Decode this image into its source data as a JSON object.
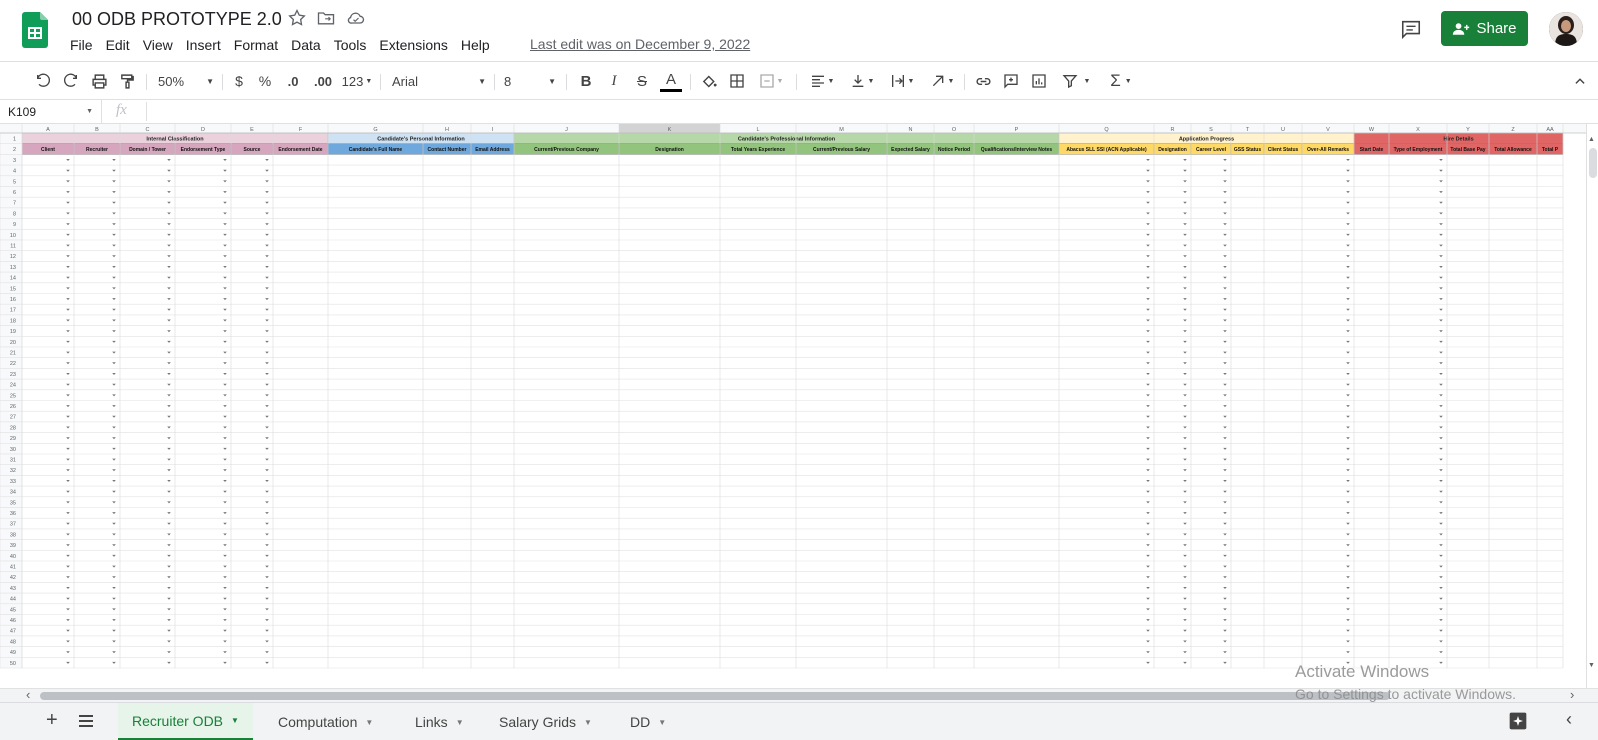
{
  "app": {
    "title": "00 ODB PROTOTYPE 2.0",
    "menu": [
      "File",
      "Edit",
      "View",
      "Insert",
      "Format",
      "Data",
      "Tools",
      "Extensions",
      "Help"
    ],
    "last_edit": "Last edit was on December 9, 2022",
    "share_label": "Share"
  },
  "toolbar": {
    "zoom": "50%",
    "currency": "$",
    "percent": "%",
    "dec_decrease": ".0",
    "dec_increase": ".00",
    "number_format": "123",
    "font": "Arial",
    "font_size": "8"
  },
  "formula_bar": {
    "cell_ref": "K109",
    "fx_label": "fx"
  },
  "sheet": {
    "col_letters": [
      "A",
      "B",
      "C",
      "D",
      "E",
      "F",
      "G",
      "H",
      "I",
      "J",
      "K",
      "L",
      "M",
      "N",
      "O",
      "P",
      "Q",
      "R",
      "S",
      "T",
      "U",
      "V",
      "W",
      "X",
      "Y",
      "Z",
      "AA"
    ],
    "groups": [
      {
        "label": "Internal Classification",
        "color": "#ead1dc",
        "header_color": "#d5a6bd"
      },
      {
        "label": "Candidate's Personal Information",
        "color": "#cfe2f3",
        "header_color": "#6fa8dc"
      },
      {
        "label": "Candidate's Professional Information",
        "color": "#b6d7a8",
        "header_color": "#93c47d"
      },
      {
        "label": "Application Progress",
        "color": "#fff2cc",
        "header_color": "#ffd966"
      },
      {
        "label": "Hire Details",
        "color": "#e06666",
        "header_color": "#e06666"
      }
    ],
    "headers": [
      "Client",
      "Recruiter",
      "Domain / Tower",
      "Endorsement Type",
      "Source",
      "Endorsement Date",
      "Candidate's Full Name",
      "Contact Number",
      "Email Address",
      "Current/Previous Company",
      "Designation",
      "Total Years Experience",
      "Current/Previous Salary",
      "Expected Salary",
      "Notice Period",
      "Qualifications/Interview Notes",
      "Abacus  SLL  SSI (ACN Applicable)",
      "Designation",
      "Career Level",
      "GSS Status",
      "Client Status",
      "Over-All Remarks",
      "Start Date",
      "Type of Employment",
      "Total Base Pay",
      "Total Allowance",
      "Total P"
    ],
    "row_numbers": [
      "1",
      "2",
      "3",
      "4",
      "5",
      "6",
      "7",
      "8",
      "9",
      "10",
      "11",
      "12",
      "13",
      "14",
      "15",
      "16",
      "17",
      "18",
      "19",
      "20",
      "21",
      "22",
      "23",
      "24",
      "25",
      "26",
      "27",
      "28",
      "29",
      "30",
      "31",
      "32",
      "33",
      "34",
      "35",
      "36",
      "37",
      "38",
      "39",
      "40",
      "41",
      "42",
      "43",
      "44",
      "45",
      "46",
      "47",
      "48",
      "49",
      "50"
    ]
  },
  "tabs": [
    "Recruiter ODB",
    "Computation",
    "Links",
    "Salary Grids",
    "DD"
  ],
  "watermark": {
    "line1": "Activate Windows",
    "line2": "Go to Settings to activate Windows."
  },
  "colors": {
    "brand_green": "#188038",
    "selected_col": "#d3d3d3"
  }
}
